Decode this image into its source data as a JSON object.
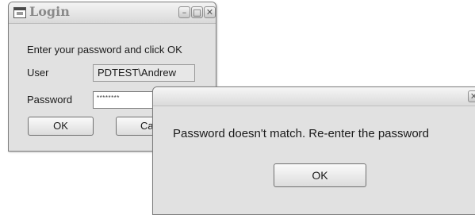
{
  "login": {
    "title": "Login",
    "instruction": "Enter your password and click OK",
    "user_label": "User",
    "user_value": "PDTEST\\Andrew",
    "password_label": "Password",
    "password_value": "********",
    "ok_label": "OK",
    "cancel_label": "Car",
    "caption": {
      "minimize": "–",
      "maximize": "□",
      "close": "✕"
    }
  },
  "message": {
    "text": "Password doesn't match. Re-enter the password",
    "ok_label": "OK",
    "close_glyph": "✕"
  }
}
